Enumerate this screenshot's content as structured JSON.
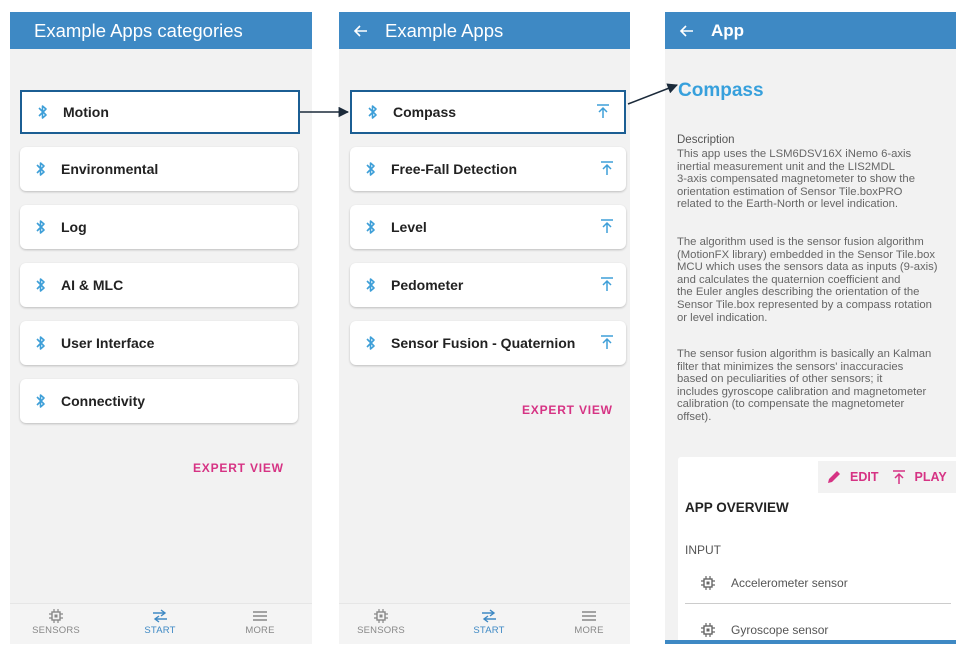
{
  "colors": {
    "appbar": "#3e89c4",
    "accent_pink": "#d63384",
    "bluetooth_blue": "#3e9fd8",
    "selection_border": "#1b5e93",
    "title_blue": "#37a0dc"
  },
  "screen1": {
    "title": "Example Apps categories",
    "items": [
      {
        "label": "Motion",
        "icon": "bluetooth-icon",
        "selected": true
      },
      {
        "label": "Environmental",
        "icon": "bluetooth-icon"
      },
      {
        "label": "Log",
        "icon": "bluetooth-icon"
      },
      {
        "label": "AI & MLC",
        "icon": "bluetooth-icon"
      },
      {
        "label": "User Interface",
        "icon": "bluetooth-icon"
      },
      {
        "label": "Connectivity",
        "icon": "bluetooth-icon"
      }
    ],
    "expert_view": "EXPERT VIEW"
  },
  "screen2": {
    "title": "Example Apps",
    "items": [
      {
        "label": "Compass",
        "icon": "bluetooth-icon",
        "action_icon": "play-icon",
        "selected": true
      },
      {
        "label": "Free-Fall Detection",
        "icon": "bluetooth-icon",
        "action_icon": "play-icon"
      },
      {
        "label": "Level",
        "icon": "bluetooth-icon",
        "action_icon": "play-icon"
      },
      {
        "label": "Pedometer",
        "icon": "bluetooth-icon",
        "action_icon": "play-icon"
      },
      {
        "label": "Sensor Fusion - Quaternion",
        "icon": "bluetooth-icon",
        "action_icon": "play-icon"
      }
    ],
    "expert_view": "EXPERT VIEW"
  },
  "screen3": {
    "title": "App",
    "app_name": "Compass",
    "description_heading": "Description",
    "description_paragraphs": [
      "This app uses the LSM6DSV16X iNemo 6-axis\ninertial measurement unit and the LIS2MDL\n3-axis compensated magnetometer to show the\norientation estimation of Sensor Tile.boxPRO\nrelated to the Earth-North or level indication.",
      "The algorithm used is the sensor fusion algorithm\n(MotionFX library) embedded in the Sensor Tile.box\nMCU which uses the sensors data as inputs (9-axis)\nand calculates the quaternion coefficient and\nthe Euler angles describing the orientation of the\nSensor Tile.box represented by a compass rotation\nor level indication.",
      "The sensor fusion algorithm is basically an Kalman\nfilter that minimizes the sensors' inaccuracies\nbased on peculiarities of other sensors; it\nincludes gyroscope calibration and magnetometer\ncalibration (to compensate the magnetometer\noffset)."
    ],
    "edit_label": "EDIT",
    "play_label": "PLAY",
    "overview_title": "APP OVERVIEW",
    "input_label": "INPUT",
    "inputs": [
      {
        "label": "Accelerometer sensor",
        "icon": "chip-icon"
      },
      {
        "label": "Gyroscope sensor",
        "icon": "chip-icon"
      }
    ]
  },
  "bottom_nav": [
    {
      "label": "SENSORS",
      "icon": "chip-icon"
    },
    {
      "label": "START",
      "icon": "start-arrows-icon",
      "active": true
    },
    {
      "label": "MORE",
      "icon": "menu-icon"
    }
  ]
}
